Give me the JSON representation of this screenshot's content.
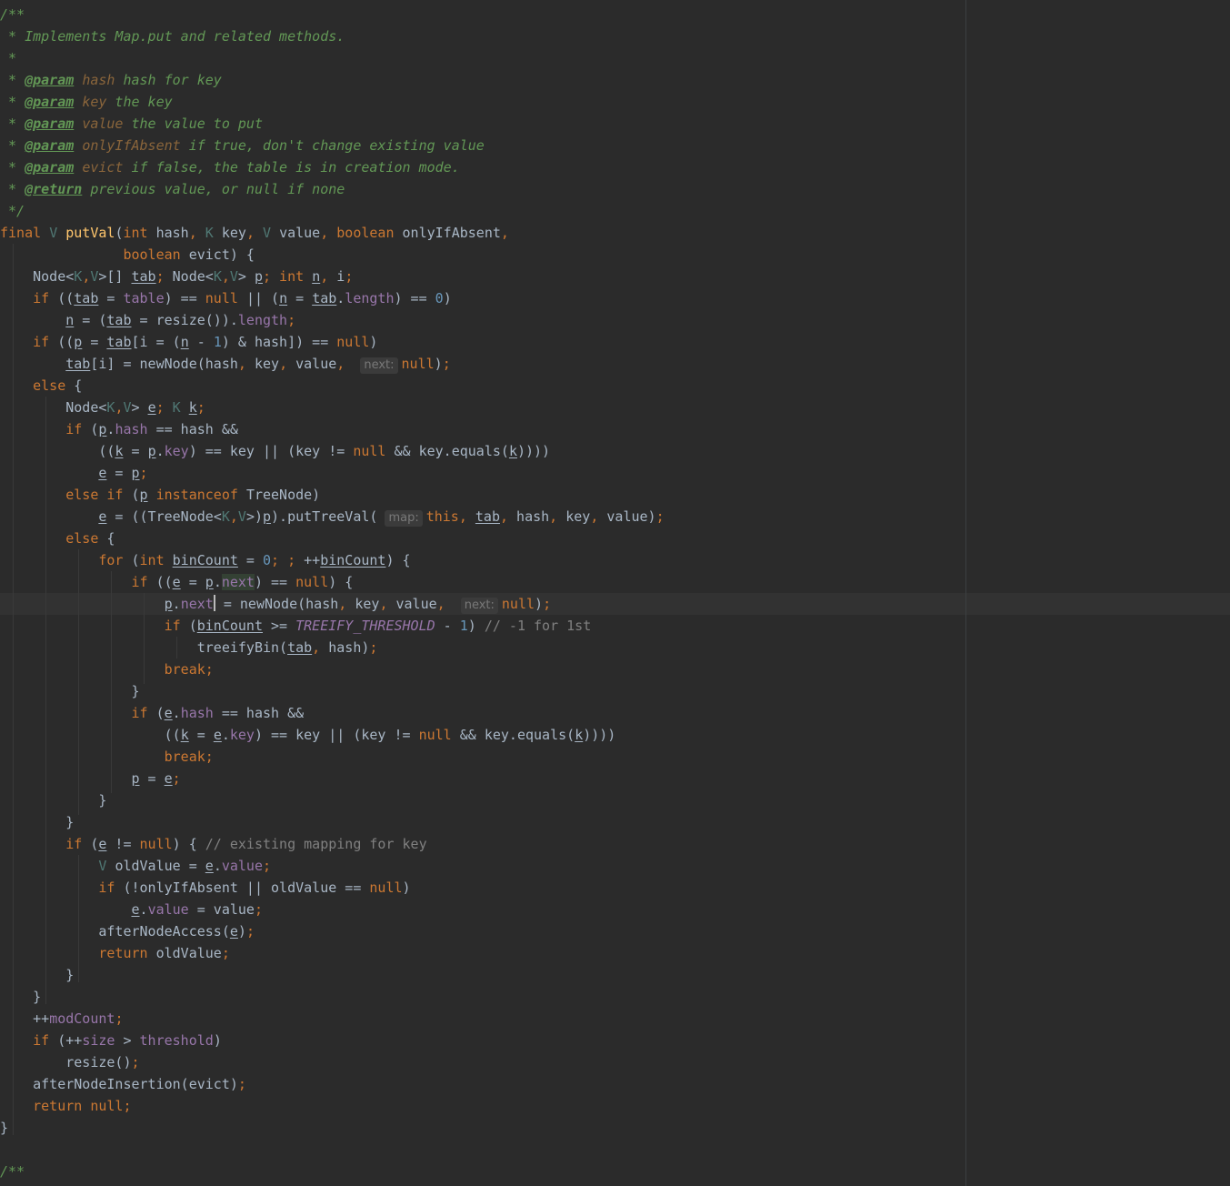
{
  "editor": {
    "language": "Java",
    "caret_line": 28,
    "colors": {
      "background": "#2b2b2b",
      "keyword": "#cc7832",
      "number": "#6897bb",
      "doc_comment": "#629755",
      "field": "#9876aa",
      "method_decl": "#ffc66d",
      "type_param": "#507874",
      "text": "#a9b7c6",
      "comment": "#808080"
    },
    "lines": [
      [
        [
          "t-doc",
          "/**"
        ]
      ],
      [
        [
          "t-doc",
          " * Implements Map.put and related methods."
        ]
      ],
      [
        [
          "t-doc",
          " *"
        ]
      ],
      [
        [
          "t-doc",
          " * "
        ],
        [
          "t-doctag",
          "@param"
        ],
        [
          "t-doc",
          " "
        ],
        [
          "t-docparam",
          "hash"
        ],
        [
          "t-doc",
          " hash for key"
        ]
      ],
      [
        [
          "t-doc",
          " * "
        ],
        [
          "t-doctag",
          "@param"
        ],
        [
          "t-doc",
          " "
        ],
        [
          "t-docparam",
          "key"
        ],
        [
          "t-doc",
          " the key"
        ]
      ],
      [
        [
          "t-doc",
          " * "
        ],
        [
          "t-doctag",
          "@param"
        ],
        [
          "t-doc",
          " "
        ],
        [
          "t-docparam",
          "value"
        ],
        [
          "t-doc",
          " the value to put"
        ]
      ],
      [
        [
          "t-doc",
          " * "
        ],
        [
          "t-doctag",
          "@param"
        ],
        [
          "t-doc",
          " "
        ],
        [
          "t-docparam",
          "onlyIfAbsent"
        ],
        [
          "t-doc",
          " if true, don't change existing value"
        ]
      ],
      [
        [
          "t-doc",
          " * "
        ],
        [
          "t-doctag",
          "@param"
        ],
        [
          "t-doc",
          " "
        ],
        [
          "t-docparam",
          "evict"
        ],
        [
          "t-doc",
          " if false, the table is in creation mode."
        ]
      ],
      [
        [
          "t-doc",
          " * "
        ],
        [
          "t-doctag",
          "@return"
        ],
        [
          "t-doc",
          " previous value, or null if none"
        ]
      ],
      [
        [
          "t-doc",
          " */"
        ]
      ],
      [
        [
          "t-kw",
          "final "
        ],
        [
          "t-type",
          "V "
        ],
        [
          "t-method",
          "putVal"
        ],
        [
          "t-plain",
          "("
        ],
        [
          "t-kw",
          "int "
        ],
        [
          "t-plain",
          "hash"
        ],
        [
          "t-kw",
          ", "
        ],
        [
          "t-type",
          "K "
        ],
        [
          "t-plain",
          "key"
        ],
        [
          "t-kw",
          ", "
        ],
        [
          "t-type",
          "V "
        ],
        [
          "t-plain",
          "value"
        ],
        [
          "t-kw",
          ", boolean "
        ],
        [
          "t-plain",
          "onlyIfAbsent"
        ],
        [
          "t-kw",
          ","
        ]
      ],
      [
        [
          "t-kw",
          "               boolean "
        ],
        [
          "t-plain",
          "evict) {"
        ]
      ],
      [
        [
          "t-plain",
          "    Node<"
        ],
        [
          "t-type",
          "K"
        ],
        [
          "t-kw",
          ","
        ],
        [
          "t-type",
          "V"
        ],
        [
          "t-plain",
          ">[] "
        ],
        [
          "t-var",
          "tab"
        ],
        [
          "t-kw",
          "; "
        ],
        [
          "t-plain",
          "Node<"
        ],
        [
          "t-type",
          "K"
        ],
        [
          "t-kw",
          ","
        ],
        [
          "t-type",
          "V"
        ],
        [
          "t-plain",
          "> "
        ],
        [
          "t-var",
          "p"
        ],
        [
          "t-kw",
          "; int "
        ],
        [
          "t-var",
          "n"
        ],
        [
          "t-kw",
          ", "
        ],
        [
          "t-plain",
          "i"
        ],
        [
          "t-kw",
          ";"
        ]
      ],
      [
        [
          "t-kw",
          "    if "
        ],
        [
          "t-plain",
          "(("
        ],
        [
          "t-var",
          "tab"
        ],
        [
          "t-plain",
          " = "
        ],
        [
          "t-field",
          "table"
        ],
        [
          "t-plain",
          ") == "
        ],
        [
          "t-kw",
          "null "
        ],
        [
          "t-plain",
          "|| ("
        ],
        [
          "t-var",
          "n"
        ],
        [
          "t-plain",
          " = "
        ],
        [
          "t-var",
          "tab"
        ],
        [
          "t-plain",
          "."
        ],
        [
          "t-field",
          "length"
        ],
        [
          "t-plain",
          ") == "
        ],
        [
          "t-num",
          "0"
        ],
        [
          "t-plain",
          ")"
        ]
      ],
      [
        [
          "t-plain",
          "        "
        ],
        [
          "t-var",
          "n"
        ],
        [
          "t-plain",
          " = ("
        ],
        [
          "t-var",
          "tab"
        ],
        [
          "t-plain",
          " = resize())."
        ],
        [
          "t-field",
          "length"
        ],
        [
          "t-kw",
          ";"
        ]
      ],
      [
        [
          "t-kw",
          "    if "
        ],
        [
          "t-plain",
          "(("
        ],
        [
          "t-var",
          "p"
        ],
        [
          "t-plain",
          " = "
        ],
        [
          "t-var",
          "tab"
        ],
        [
          "t-plain",
          "[i = ("
        ],
        [
          "t-var",
          "n"
        ],
        [
          "t-plain",
          " - "
        ],
        [
          "t-num",
          "1"
        ],
        [
          "t-plain",
          ") & hash]) == "
        ],
        [
          "t-kw",
          "null"
        ],
        [
          "t-plain",
          ")"
        ]
      ],
      [
        [
          "t-plain",
          "        "
        ],
        [
          "t-var",
          "tab"
        ],
        [
          "t-plain",
          "[i] = newNode(hash"
        ],
        [
          "t-kw",
          ", "
        ],
        [
          "t-plain",
          "key"
        ],
        [
          "t-kw",
          ", "
        ],
        [
          "t-plain",
          "value"
        ],
        [
          "t-kw",
          ", "
        ],
        [
          "t-hint",
          "next:"
        ],
        [
          "t-kw",
          "null"
        ],
        [
          "t-plain",
          ")"
        ],
        [
          "t-kw",
          ";"
        ]
      ],
      [
        [
          "t-kw",
          "    else "
        ],
        [
          "t-plain",
          "{"
        ]
      ],
      [
        [
          "t-plain",
          "        Node<"
        ],
        [
          "t-type",
          "K"
        ],
        [
          "t-kw",
          ","
        ],
        [
          "t-type",
          "V"
        ],
        [
          "t-plain",
          "> "
        ],
        [
          "t-var",
          "e"
        ],
        [
          "t-kw",
          "; "
        ],
        [
          "t-type",
          "K "
        ],
        [
          "t-var",
          "k"
        ],
        [
          "t-kw",
          ";"
        ]
      ],
      [
        [
          "t-kw",
          "        if "
        ],
        [
          "t-plain",
          "("
        ],
        [
          "t-var",
          "p"
        ],
        [
          "t-plain",
          "."
        ],
        [
          "t-field",
          "hash"
        ],
        [
          "t-plain",
          " == hash &&"
        ]
      ],
      [
        [
          "t-plain",
          "            (("
        ],
        [
          "t-var",
          "k"
        ],
        [
          "t-plain",
          " = "
        ],
        [
          "t-var",
          "p"
        ],
        [
          "t-plain",
          "."
        ],
        [
          "t-field",
          "key"
        ],
        [
          "t-plain",
          ") == key || (key != "
        ],
        [
          "t-kw",
          "null "
        ],
        [
          "t-plain",
          "&& key.equals("
        ],
        [
          "t-var",
          "k"
        ],
        [
          "t-plain",
          "))))"
        ]
      ],
      [
        [
          "t-plain",
          "            "
        ],
        [
          "t-var",
          "e"
        ],
        [
          "t-plain",
          " = "
        ],
        [
          "t-var",
          "p"
        ],
        [
          "t-kw",
          ";"
        ]
      ],
      [
        [
          "t-kw",
          "        else if "
        ],
        [
          "t-plain",
          "("
        ],
        [
          "t-var",
          "p"
        ],
        [
          "t-kw",
          " instanceof "
        ],
        [
          "t-plain",
          "TreeNode)"
        ]
      ],
      [
        [
          "t-plain",
          "            "
        ],
        [
          "t-var",
          "e"
        ],
        [
          "t-plain",
          " = ((TreeNode<"
        ],
        [
          "t-type",
          "K"
        ],
        [
          "t-kw",
          ","
        ],
        [
          "t-type",
          "V"
        ],
        [
          "t-plain",
          ">)"
        ],
        [
          "t-var",
          "p"
        ],
        [
          "t-plain",
          ").putTreeVal("
        ],
        [
          "t-hint",
          "map:"
        ],
        [
          "t-kw",
          "this, "
        ],
        [
          "t-var",
          "tab"
        ],
        [
          "t-kw",
          ", "
        ],
        [
          "t-plain",
          "hash"
        ],
        [
          "t-kw",
          ", "
        ],
        [
          "t-plain",
          "key"
        ],
        [
          "t-kw",
          ", "
        ],
        [
          "t-plain",
          "value)"
        ],
        [
          "t-kw",
          ";"
        ]
      ],
      [
        [
          "t-kw",
          "        else "
        ],
        [
          "t-plain",
          "{"
        ]
      ],
      [
        [
          "t-kw",
          "            for "
        ],
        [
          "t-plain",
          "("
        ],
        [
          "t-kw",
          "int "
        ],
        [
          "t-var",
          "binCount"
        ],
        [
          "t-plain",
          " = "
        ],
        [
          "t-num",
          "0"
        ],
        [
          "t-kw",
          "; ; "
        ],
        [
          "t-plain",
          "++"
        ],
        [
          "t-var",
          "binCount"
        ],
        [
          "t-plain",
          ") {"
        ]
      ],
      [
        [
          "t-kw",
          "                if "
        ],
        [
          "t-plain",
          "(("
        ],
        [
          "t-var",
          "e"
        ],
        [
          "t-plain",
          " = "
        ],
        [
          "t-var",
          "p"
        ],
        [
          "t-plain",
          "."
        ],
        [
          "t-hl",
          "next"
        ],
        [
          "t-plain",
          ") == "
        ],
        [
          "t-kw",
          "null"
        ],
        [
          "t-plain",
          ") {"
        ]
      ],
      [
        [
          "t-plain",
          "                    "
        ],
        [
          "t-var",
          "p"
        ],
        [
          "t-plain",
          "."
        ],
        [
          "t-field",
          "next"
        ],
        [
          "caret",
          ""
        ],
        [
          "t-plain",
          " = newNode(hash"
        ],
        [
          "t-kw",
          ", "
        ],
        [
          "t-plain",
          "key"
        ],
        [
          "t-kw",
          ", "
        ],
        [
          "t-plain",
          "value"
        ],
        [
          "t-kw",
          ", "
        ],
        [
          "t-hint",
          "next:"
        ],
        [
          "t-kw",
          "null"
        ],
        [
          "t-plain",
          ")"
        ],
        [
          "t-kw",
          ";"
        ]
      ],
      [
        [
          "t-kw",
          "                    if "
        ],
        [
          "t-plain",
          "("
        ],
        [
          "t-var",
          "binCount"
        ],
        [
          "t-plain",
          " >= "
        ],
        [
          "t-const",
          "TREEIFY_THRESHOLD"
        ],
        [
          "t-plain",
          " - "
        ],
        [
          "t-num",
          "1"
        ],
        [
          "t-plain",
          ") "
        ],
        [
          "t-comment",
          "// -1 for 1st"
        ]
      ],
      [
        [
          "t-plain",
          "                        treeifyBin("
        ],
        [
          "t-var",
          "tab"
        ],
        [
          "t-kw",
          ", "
        ],
        [
          "t-plain",
          "hash)"
        ],
        [
          "t-kw",
          ";"
        ]
      ],
      [
        [
          "t-kw",
          "                    break;"
        ]
      ],
      [
        [
          "t-plain",
          "                }"
        ]
      ],
      [
        [
          "t-kw",
          "                if "
        ],
        [
          "t-plain",
          "("
        ],
        [
          "t-var",
          "e"
        ],
        [
          "t-plain",
          "."
        ],
        [
          "t-field",
          "hash"
        ],
        [
          "t-plain",
          " == hash &&"
        ]
      ],
      [
        [
          "t-plain",
          "                    (("
        ],
        [
          "t-var",
          "k"
        ],
        [
          "t-plain",
          " = "
        ],
        [
          "t-var",
          "e"
        ],
        [
          "t-plain",
          "."
        ],
        [
          "t-field",
          "key"
        ],
        [
          "t-plain",
          ") == key || (key != "
        ],
        [
          "t-kw",
          "null "
        ],
        [
          "t-plain",
          "&& key.equals("
        ],
        [
          "t-var",
          "k"
        ],
        [
          "t-plain",
          "))))"
        ]
      ],
      [
        [
          "t-kw",
          "                    break;"
        ]
      ],
      [
        [
          "t-plain",
          "                "
        ],
        [
          "t-var",
          "p"
        ],
        [
          "t-plain",
          " = "
        ],
        [
          "t-var",
          "e"
        ],
        [
          "t-kw",
          ";"
        ]
      ],
      [
        [
          "t-plain",
          "            }"
        ]
      ],
      [
        [
          "t-plain",
          "        }"
        ]
      ],
      [
        [
          "t-kw",
          "        if "
        ],
        [
          "t-plain",
          "("
        ],
        [
          "t-var",
          "e"
        ],
        [
          "t-plain",
          " != "
        ],
        [
          "t-kw",
          "null"
        ],
        [
          "t-plain",
          ") { "
        ],
        [
          "t-comment",
          "// existing mapping for key"
        ]
      ],
      [
        [
          "t-plain",
          "            "
        ],
        [
          "t-type",
          "V "
        ],
        [
          "t-plain",
          "oldValue = "
        ],
        [
          "t-var",
          "e"
        ],
        [
          "t-plain",
          "."
        ],
        [
          "t-field",
          "value"
        ],
        [
          "t-kw",
          ";"
        ]
      ],
      [
        [
          "t-kw",
          "            if "
        ],
        [
          "t-plain",
          "(!onlyIfAbsent || oldValue == "
        ],
        [
          "t-kw",
          "null"
        ],
        [
          "t-plain",
          ")"
        ]
      ],
      [
        [
          "t-plain",
          "                "
        ],
        [
          "t-var",
          "e"
        ],
        [
          "t-plain",
          "."
        ],
        [
          "t-field",
          "value"
        ],
        [
          "t-plain",
          " = value"
        ],
        [
          "t-kw",
          ";"
        ]
      ],
      [
        [
          "t-plain",
          "            afterNodeAccess("
        ],
        [
          "t-var",
          "e"
        ],
        [
          "t-plain",
          ")"
        ],
        [
          "t-kw",
          ";"
        ]
      ],
      [
        [
          "t-kw",
          "            return "
        ],
        [
          "t-plain",
          "oldValue"
        ],
        [
          "t-kw",
          ";"
        ]
      ],
      [
        [
          "t-plain",
          "        }"
        ]
      ],
      [
        [
          "t-plain",
          "    }"
        ]
      ],
      [
        [
          "t-plain",
          "    ++"
        ],
        [
          "t-field",
          "modCount"
        ],
        [
          "t-kw",
          ";"
        ]
      ],
      [
        [
          "t-kw",
          "    if "
        ],
        [
          "t-plain",
          "(++"
        ],
        [
          "t-field",
          "size"
        ],
        [
          "t-plain",
          " > "
        ],
        [
          "t-field",
          "threshold"
        ],
        [
          "t-plain",
          ")"
        ]
      ],
      [
        [
          "t-plain",
          "        resize()"
        ],
        [
          "t-kw",
          ";"
        ]
      ],
      [
        [
          "t-plain",
          "    afterNodeInsertion(evict)"
        ],
        [
          "t-kw",
          ";"
        ]
      ],
      [
        [
          "t-kw",
          "    return null;"
        ]
      ],
      [
        [
          "t-plain",
          "}"
        ]
      ],
      [
        [
          "t-plain",
          ""
        ]
      ],
      [
        [
          "t-doc",
          "/**"
        ]
      ]
    ]
  }
}
